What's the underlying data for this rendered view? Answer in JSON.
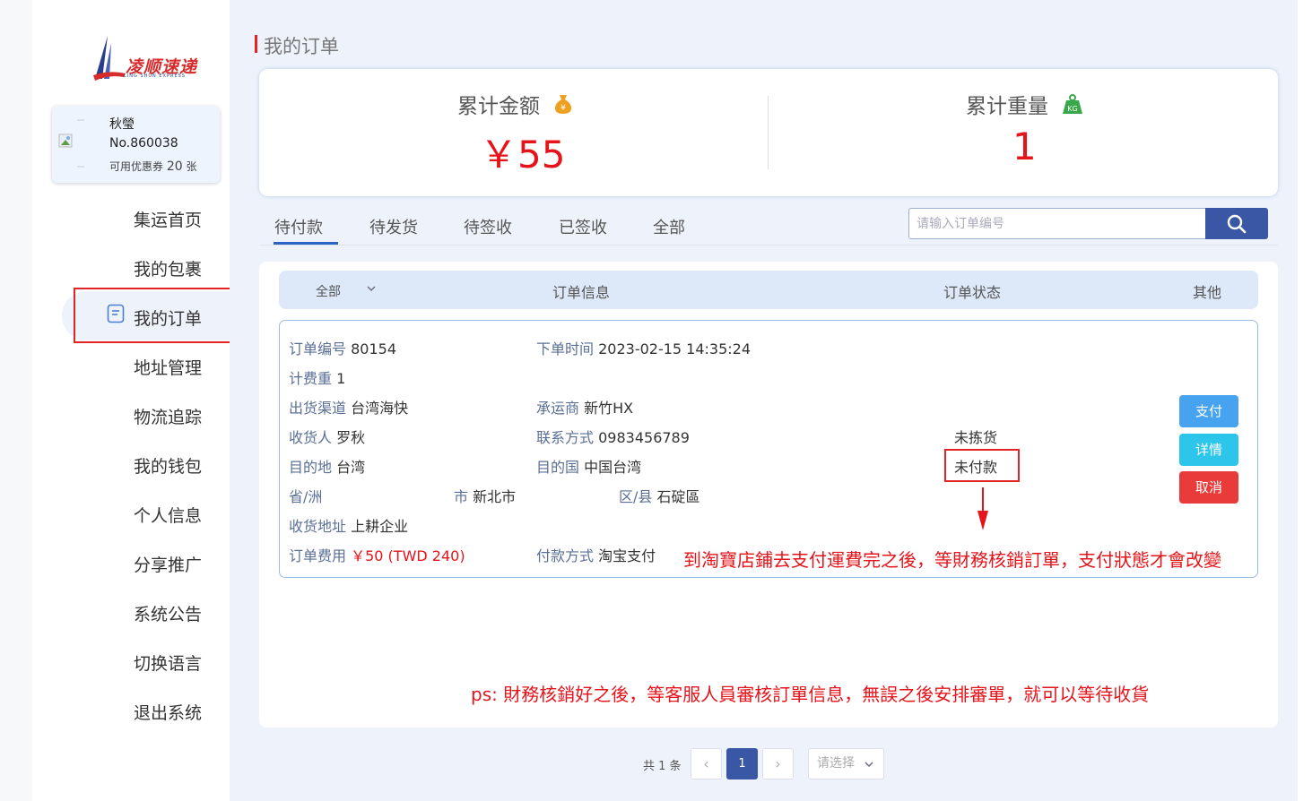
{
  "brand": {
    "name": "凌顺速递",
    "sub": "LING SHUN EXPRESS"
  },
  "user": {
    "name": "秋瑩",
    "number": "No.860038",
    "coupon_prefix": "可用优惠券",
    "coupon_count": "20",
    "coupon_unit": "张"
  },
  "nav": {
    "items": [
      {
        "label": "集运首页"
      },
      {
        "label": "我的包裹"
      },
      {
        "label": "我的订单",
        "active": true
      },
      {
        "label": "地址管理"
      },
      {
        "label": "物流追踪"
      },
      {
        "label": "我的钱包"
      },
      {
        "label": "个人信息"
      },
      {
        "label": "分享推广"
      },
      {
        "label": "系统公告"
      },
      {
        "label": "切换语言"
      },
      {
        "label": "退出系统"
      }
    ]
  },
  "page": {
    "title": "我的订单"
  },
  "stats": {
    "amount_label": "累计金额",
    "amount_value": "￥55",
    "weight_label": "累计重量",
    "weight_value": "1"
  },
  "tabs": [
    "待付款",
    "待发货",
    "待签收",
    "已签收",
    "全部"
  ],
  "search": {
    "placeholder": "请输入订单编号"
  },
  "table": {
    "filter": "全部",
    "headers": {
      "info": "订单信息",
      "status": "订单状态",
      "other": "其他"
    }
  },
  "order": {
    "number_k": "订单编号",
    "number_v": "80154",
    "time_k": "下单时间",
    "time_v": "2023-02-15 14:35:24",
    "weight_k": "计费重",
    "weight_v": "1",
    "channel_k": "出货渠道",
    "channel_v": "台湾海快",
    "carrier_k": "承运商",
    "carrier_v": "新竹HX",
    "receiver_k": "收货人",
    "receiver_v": "罗秋",
    "phone_k": "联系方式",
    "phone_v": "0983456789",
    "dest_k": "目的地",
    "dest_v": "台湾",
    "country_k": "目的国",
    "country_v": "中国台湾",
    "province_k": "省/洲",
    "province_v": "",
    "city_k": "市",
    "city_v": "新北市",
    "district_k": "区/县",
    "district_v": "石碇區",
    "address_k": "收货地址",
    "address_v": "上耕企业",
    "fee_k": "订单费用",
    "fee_v": "￥50 (TWD 240)",
    "paymethod_k": "付款方式",
    "paymethod_v": "淘宝支付",
    "status_pick": "未拣货",
    "status_pay": "未付款",
    "btn_pay": "支付",
    "btn_detail": "详情",
    "btn_cancel": "取消"
  },
  "annotations": {
    "note1": "到淘寶店鋪去支付運費完之後，等財務核銷訂單，支付狀態才會改變",
    "note2": "ps: 財務核銷好之後，等客服人員審核訂單信息，無誤之後安排審單，就可以等待收貨",
    "color": "#e5141b"
  },
  "pagination": {
    "total": "共 1 条",
    "current": "1",
    "prev": "‹",
    "next": "›",
    "select_placeholder": "请选择"
  }
}
